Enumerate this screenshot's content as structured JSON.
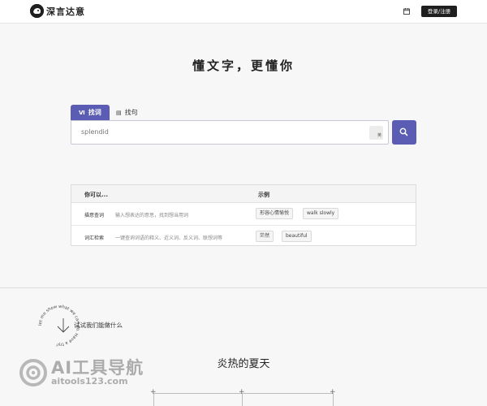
{
  "header": {
    "brand": "深言达意",
    "login_label": "登录/注册",
    "icons": [
      "logo-icon",
      "calendar-icon"
    ]
  },
  "hero": {
    "title": "懂文字，更懂你"
  },
  "search": {
    "tabs": [
      {
        "label": "找词",
        "icon": "word-icon",
        "active": true
      },
      {
        "label": "找句",
        "icon": "sentence-icon",
        "active": false
      }
    ],
    "placeholder": "splendid",
    "keyboard_label": "英",
    "button_icon": "search-icon"
  },
  "panel": {
    "header_col1": "你可以...",
    "header_col2": "示例",
    "rows": [
      {
        "name": "描意查词",
        "desc": "输入想表达的意思，找到想当用词",
        "examples": [
          "形容心情愉悦",
          "walk slowly"
        ]
      },
      {
        "name": "词汇检索",
        "desc": "一键查询词语的释义、近义词、反义词、联想词等",
        "examples": [
          "茫然",
          "beautiful"
        ]
      }
    ]
  },
  "try_section": {
    "circle_text": "let me show what we can do. Have a try!",
    "label": "试试我们能做什么"
  },
  "watermark": {
    "line1": "AI工具导航",
    "line2": "aitools123.com"
  },
  "section": {
    "title": "炎热的夏天"
  },
  "colors": {
    "accent": "#5b5db5",
    "dark": "#1f1f1f",
    "background": "#f7f7f7"
  }
}
